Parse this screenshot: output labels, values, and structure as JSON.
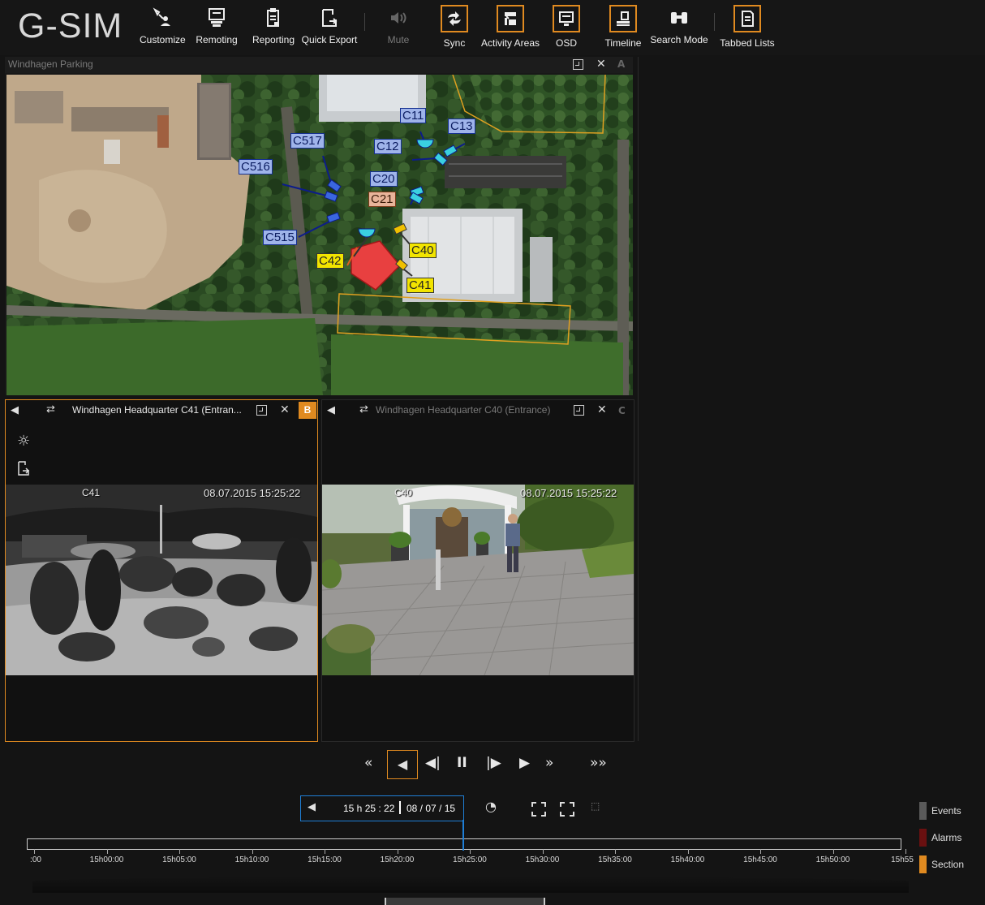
{
  "app": {
    "logo": "G-SIM",
    "toolbar": [
      {
        "key": "customize",
        "label": "Customize",
        "icon": "customize-icon",
        "active": false,
        "dim": false
      },
      {
        "key": "remoting",
        "label": "Remoting",
        "icon": "remoting-icon",
        "active": false,
        "dim": false
      },
      {
        "key": "reporting",
        "label": "Reporting",
        "icon": "reporting-icon",
        "active": false,
        "dim": false
      },
      {
        "key": "quick_export",
        "label": "Quick Export",
        "icon": "export-icon",
        "active": false,
        "dim": false
      },
      {
        "key": "mute",
        "label": "Mute",
        "icon": "speaker-icon",
        "active": false,
        "dim": true
      },
      {
        "key": "sync",
        "label": "Sync",
        "icon": "sync-icon",
        "active": true,
        "dim": false
      },
      {
        "key": "activity_areas",
        "label": "Activity Areas",
        "icon": "activity-areas-icon",
        "active": true,
        "dim": false
      },
      {
        "key": "osd",
        "label": "OSD",
        "icon": "osd-icon",
        "active": true,
        "dim": false
      },
      {
        "key": "timeline",
        "label": "Timeline",
        "icon": "timeline-icon",
        "active": true,
        "dim": false
      },
      {
        "key": "search_mode",
        "label": "Search Mode",
        "icon": "binoculars-icon",
        "active": false,
        "dim": false
      },
      {
        "key": "tabbed_lists",
        "label": "Tabbed Lists",
        "icon": "tabbed-lists-icon",
        "active": true,
        "dim": false
      }
    ]
  },
  "map_pane": {
    "title": "Windhagen Parking",
    "letter": "A",
    "cameras": {
      "c11": "C11",
      "c13": "C13",
      "c12": "C12",
      "c517": "C517",
      "c516": "C516",
      "c20": "C20",
      "c21": "C21",
      "c515": "C515",
      "c40": "C40",
      "c42": "C42",
      "c41": "C41"
    }
  },
  "video_b": {
    "title": "Windhagen Headquarter C41 (Entran...",
    "letter": "B",
    "camera_label": "C41",
    "timestamp": "08.07.2015 15:25:22"
  },
  "video_c": {
    "title": "Windhagen Headquarter C40 (Entrance)",
    "letter": "C",
    "camera_label": "C40",
    "timestamp": "08.07.2015 15:25:22"
  },
  "playback": {
    "time": "15 h 25 : 22",
    "date": "08 / 07 / 15",
    "ticks": [
      ":00",
      "15h00:00",
      "15h05:00",
      "15h10:00",
      "15h15:00",
      "15h20:00",
      "15h25:00",
      "15h30:00",
      "15h35:00",
      "15h40:00",
      "15h45:00",
      "15h50:00",
      "15h55"
    ],
    "legend": [
      {
        "label": "Events",
        "color": "#5a5a5a"
      },
      {
        "label": "Alarms",
        "color": "#6a1010"
      },
      {
        "label": "Section",
        "color": "#e08a20"
      }
    ]
  },
  "colors": {
    "accent": "#e08a20",
    "cursor": "#1f7fd6",
    "blue_camera": "#15308f",
    "yellow_camera": "#f2e400"
  }
}
